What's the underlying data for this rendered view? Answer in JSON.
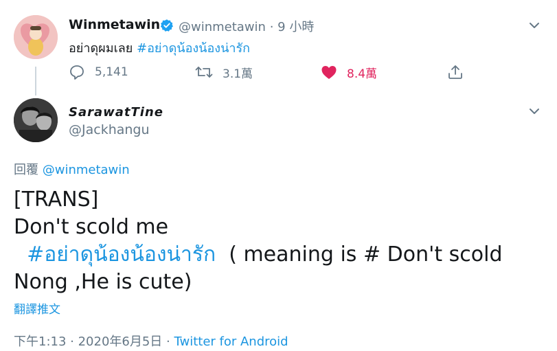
{
  "tweet1": {
    "display_name": "Winmetawin",
    "handle": "@winmetawin",
    "time": "· 9 小時",
    "text_prefix": "อย่าดุผมเลย ",
    "hashtag": "#อย่าดุน้องน้องน่ารัก",
    "replies": "5,141",
    "retweets": "3.1萬",
    "likes": "8.4萬"
  },
  "tweet2": {
    "display_name": "SarawatTine",
    "handle": "@Jackhangu",
    "reply_label": "回覆",
    "reply_handle": "@winmetawin",
    "line1": "[TRANS]",
    "line2": "Don't scold me",
    "hashtag": "#อย่าดุน้องน้องน่ารัก",
    "line3_rest": "( meaning is # Don't scold",
    "line4": "Nong  ,He is cute)",
    "translate": "翻譯推文",
    "timestamp": "下午1:13 · 2020年6月5日 · ",
    "source": "Twitter for Android"
  },
  "colors": {
    "accent": "#1b95e0",
    "like": "#e0245e",
    "muted": "#657786",
    "text": "#14171a"
  }
}
